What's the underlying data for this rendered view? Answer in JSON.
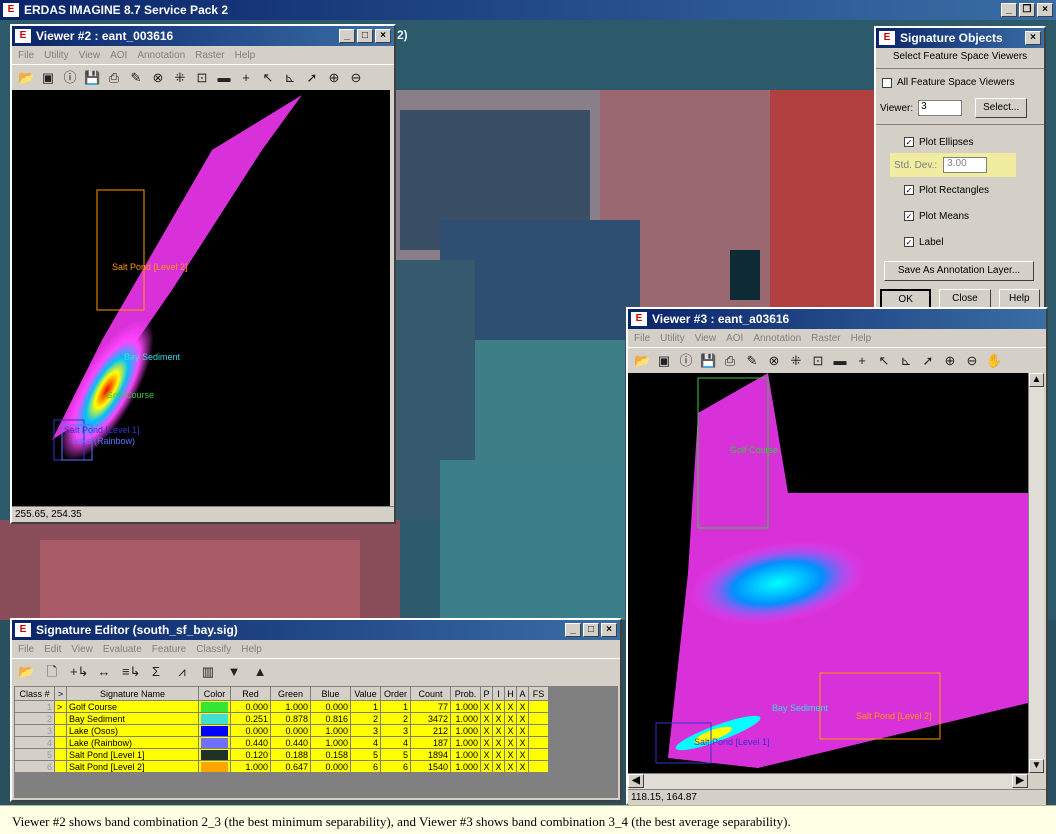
{
  "app": {
    "title": "ERDAS IMAGINE 8.7 Service Pack 2",
    "behind_title_fragment": "2)"
  },
  "viewer2": {
    "title": "Viewer #2 : eant_003616",
    "menu": [
      "File",
      "Utility",
      "View",
      "AOI",
      "Annotation",
      "Raster",
      "Help"
    ],
    "status": "255.65, 254.35",
    "labels": [
      {
        "text": "Salt Pond [Level 2]",
        "color": "#ff9900"
      },
      {
        "text": "Bay Sediment",
        "color": "#33dddd"
      },
      {
        "text": "Golf Course",
        "color": "#33cc33"
      },
      {
        "text": "Salt Pond [Level 1]",
        "color": "#3333cc"
      },
      {
        "text": "Lake (Rainbow)",
        "color": "#5577ff"
      }
    ]
  },
  "viewer3": {
    "title": "Viewer #3 : eant_a03616",
    "menu": [
      "File",
      "Utility",
      "View",
      "AOI",
      "Annotation",
      "Raster",
      "Help"
    ],
    "status": "118.15, 164.87",
    "labels": [
      {
        "text": "Golf Course",
        "color": "#33cc33"
      },
      {
        "text": "Bay Sediment",
        "color": "#33dddd"
      },
      {
        "text": "Salt Pond [Level 2]",
        "color": "#ff9900"
      },
      {
        "text": "Salt Pond [Level 1]",
        "color": "#3333cc"
      }
    ]
  },
  "sig_objects": {
    "title": "Signature Objects",
    "header": "Select Feature Space Viewers",
    "all_viewers_label": "All Feature Space Viewers",
    "all_viewers_checked": false,
    "viewer_label": "Viewer:",
    "viewer_value": "3",
    "select_button": "Select...",
    "plot_ellipses": "Plot Ellipses",
    "std_dev_label": "Std. Dev.:",
    "std_dev_value": "3.00",
    "plot_rectangles": "Plot Rectangles",
    "plot_means": "Plot Means",
    "label": "Label",
    "save_button": "Save As Annotation Layer...",
    "ok_button": "OK",
    "close_button": "Close",
    "help_button": "Help"
  },
  "sig_editor": {
    "title": "Signature Editor (south_sf_bay.sig)",
    "menu": [
      "File",
      "Edit",
      "View",
      "Evaluate",
      "Feature",
      "Classify",
      "Help"
    ],
    "columns": [
      "Class #",
      ">",
      "Signature Name",
      "Color",
      "Red",
      "Green",
      "Blue",
      "Value",
      "Order",
      "Count",
      "Prob.",
      "P",
      "I",
      "H",
      "A",
      "FS"
    ],
    "rows": [
      {
        "cls": "1",
        "cur": ">",
        "name": "Golf Course",
        "color": "#33e633",
        "red": "0.000",
        "green": "1.000",
        "blue": "0.000",
        "value": "1",
        "order": "1",
        "count": "77",
        "prob": "1.000"
      },
      {
        "cls": "2",
        "cur": "",
        "name": "Bay Sediment",
        "color": "#40e0d0",
        "red": "0.251",
        "green": "0.878",
        "blue": "0.816",
        "value": "2",
        "order": "2",
        "count": "3472",
        "prob": "1.000"
      },
      {
        "cls": "3",
        "cur": "",
        "name": "Lake (Osos)",
        "color": "#0000ff",
        "red": "0.000",
        "green": "0.000",
        "blue": "1.000",
        "value": "3",
        "order": "3",
        "count": "212",
        "prob": "1.000"
      },
      {
        "cls": "4",
        "cur": "",
        "name": "Lake (Rainbow)",
        "color": "#7070ff",
        "red": "0.440",
        "green": "0.440",
        "blue": "1.000",
        "value": "4",
        "order": "4",
        "count": "187",
        "prob": "1.000"
      },
      {
        "cls": "5",
        "cur": "",
        "name": "Salt Pond [Level 1]",
        "color": "#1e3028",
        "red": "0.120",
        "green": "0.188",
        "blue": "0.158",
        "value": "5",
        "order": "5",
        "count": "1894",
        "prob": "1.000"
      },
      {
        "cls": "6",
        "cur": "",
        "name": "Salt Pond [Level 2]",
        "color": "#ffa500",
        "red": "1.000",
        "green": "0.647",
        "blue": "0.000",
        "value": "6",
        "order": "6",
        "count": "1540",
        "prob": "1.000"
      }
    ],
    "mark": "X"
  },
  "caption": "Viewer #2 shows band combination 2_3 (the best minimum separability), and Viewer #3 shows band combination 3_4 (the best average separability)."
}
